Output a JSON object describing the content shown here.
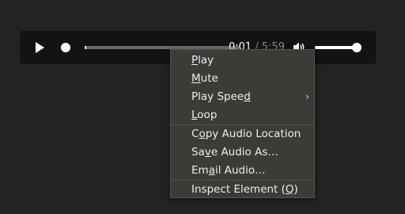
{
  "player": {
    "current_time": "0:01",
    "separator": "/",
    "duration": "5:59",
    "progress_fraction": 0.006,
    "volume_fraction": 1.0
  },
  "context_menu": {
    "items": [
      {
        "label": "Play",
        "mnemonic": "P",
        "has_submenu": false
      },
      {
        "label": "Mute",
        "mnemonic": "M",
        "has_submenu": false
      },
      {
        "label": "Play Speed",
        "mnemonic": "d",
        "has_submenu": true
      },
      {
        "label": "Loop",
        "mnemonic": "L",
        "has_submenu": false
      },
      {
        "label": "Copy Audio Location",
        "mnemonic": "o",
        "has_submenu": false
      },
      {
        "label": "Save Audio As…",
        "mnemonic": "v",
        "has_submenu": false
      },
      {
        "label": "Email Audio…",
        "mnemonic": "a",
        "has_submenu": false
      },
      {
        "label": "Inspect Element (Q)",
        "mnemonic": "Q",
        "has_submenu": false
      }
    ]
  },
  "colors": {
    "page_background": "#232323",
    "player_background": "#131313",
    "menu_background": "#3b3b38",
    "menu_text": "#ececec",
    "control_white": "#ffffff",
    "track_gray": "#6b6b6b"
  },
  "icons": {
    "play": "play-icon",
    "volume": "speaker-icon",
    "submenu": "chevron-right-icon"
  }
}
